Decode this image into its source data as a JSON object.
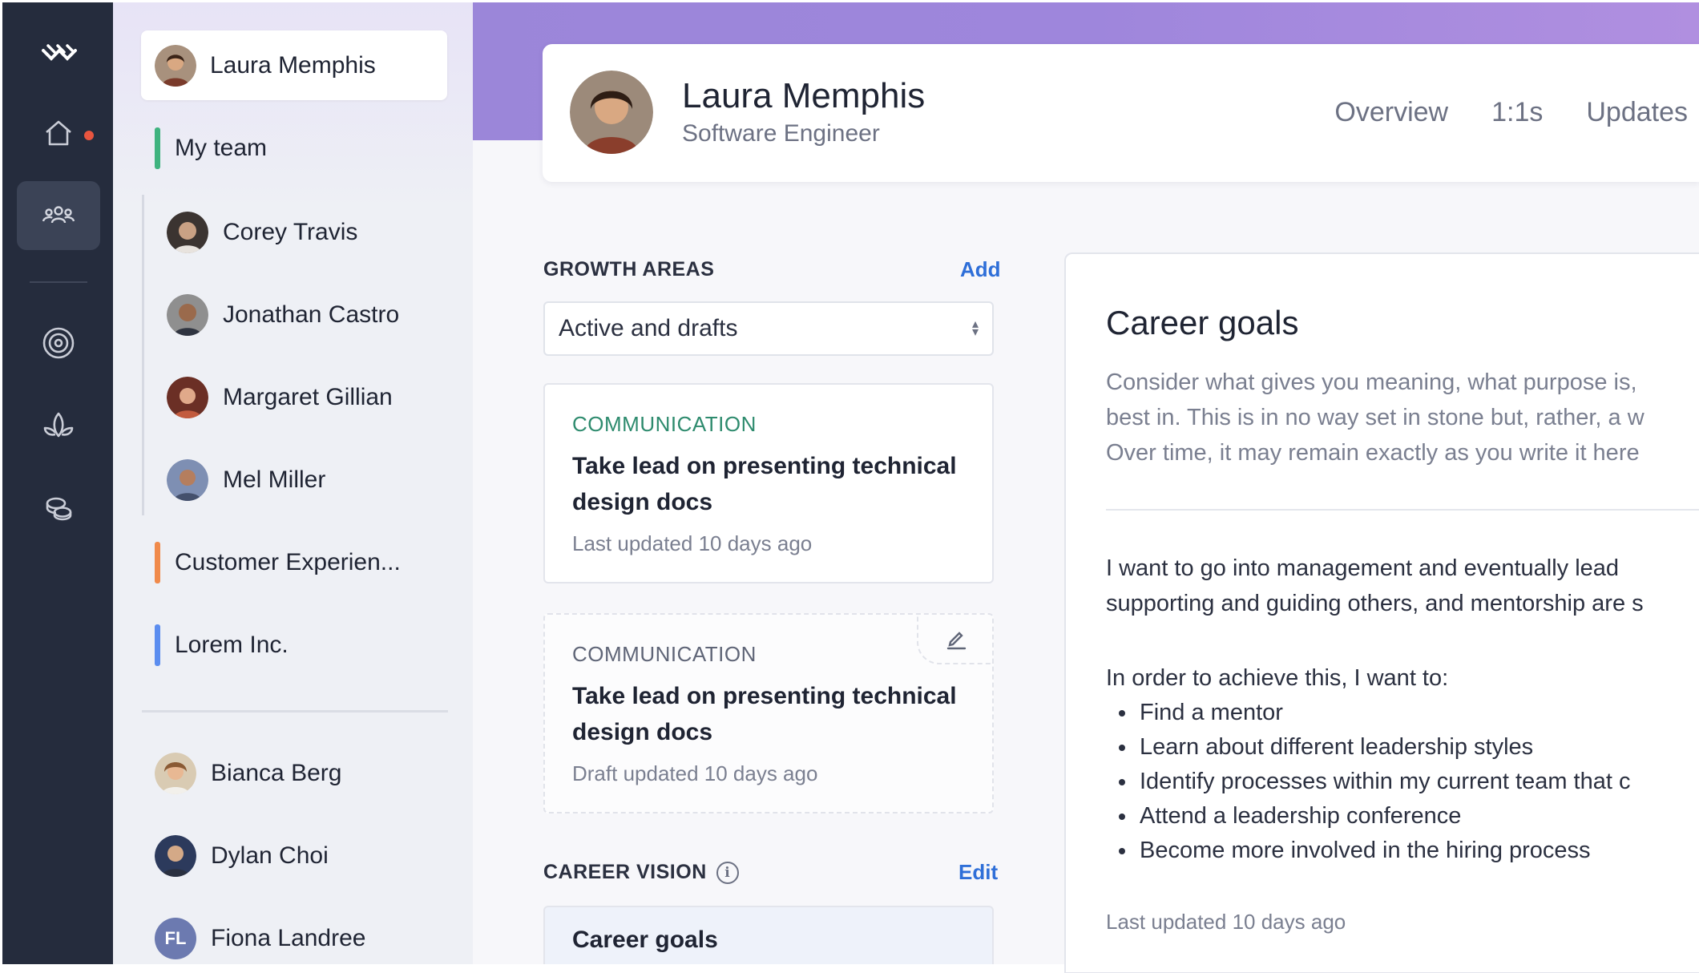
{
  "sidebar_nav": {
    "items": [
      {
        "icon": "home-icon"
      },
      {
        "icon": "team-icon",
        "active": true
      },
      {
        "icon": "target-icon"
      },
      {
        "icon": "lotus-icon"
      },
      {
        "icon": "coins-icon"
      }
    ],
    "notification_dot_color": "#e8553f"
  },
  "side_panel": {
    "current_user": {
      "name": "Laura Memphis"
    },
    "groups": [
      {
        "label": "My team",
        "color": "#3fb37f"
      },
      {
        "label": "Customer Experien...",
        "color": "#f08a4b"
      },
      {
        "label": "Lorem Inc.",
        "color": "#5b8def"
      }
    ],
    "team_members": [
      {
        "name": "Corey Travis"
      },
      {
        "name": "Jonathan Castro"
      },
      {
        "name": "Margaret Gillian"
      },
      {
        "name": "Mel Miller"
      }
    ],
    "people": [
      {
        "name": "Bianca Berg"
      },
      {
        "name": "Dylan Choi"
      },
      {
        "name": "Fiona Landree",
        "initials": "FL"
      }
    ]
  },
  "profile": {
    "name": "Laura Memphis",
    "role": "Software Engineer",
    "tabs": [
      "Overview",
      "1:1s",
      "Updates"
    ]
  },
  "growth_areas": {
    "heading": "GROWTH AREAS",
    "add_label": "Add",
    "filter": "Active and drafts",
    "cards": [
      {
        "category": "COMMUNICATION",
        "title_line1": "Take lead on presenting technical",
        "title_line2": "design docs",
        "meta": "Last updated 10 days ago",
        "category_color": "#2e8b6e"
      },
      {
        "category": "COMMUNICATION",
        "title_line1": "Take lead on presenting technical",
        "title_line2": "design docs",
        "meta": "Draft updated 10 days ago",
        "category_color": "#5f6577"
      }
    ]
  },
  "career_vision": {
    "heading": "CAREER VISION",
    "edit_label": "Edit",
    "preview_title": "Career goals"
  },
  "career_goals": {
    "title": "Career goals",
    "hint_lines": [
      "Consider what gives you meaning, what purpose is,",
      "best in. This is in no way set in stone but, rather, a w",
      "Over time, it may remain exactly as you write it here"
    ],
    "body_lines": [
      "I want to go into management and eventually lead",
      "supporting and guiding others, and mentorship are s"
    ],
    "intro": "In order to achieve this, I want to:",
    "items": [
      "Find a mentor",
      "Learn about different leadership styles",
      "Identify processes within my current team that c",
      "Attend a leadership conference",
      "Become more involved in the hiring process"
    ],
    "meta": "Last updated 10 days ago"
  }
}
